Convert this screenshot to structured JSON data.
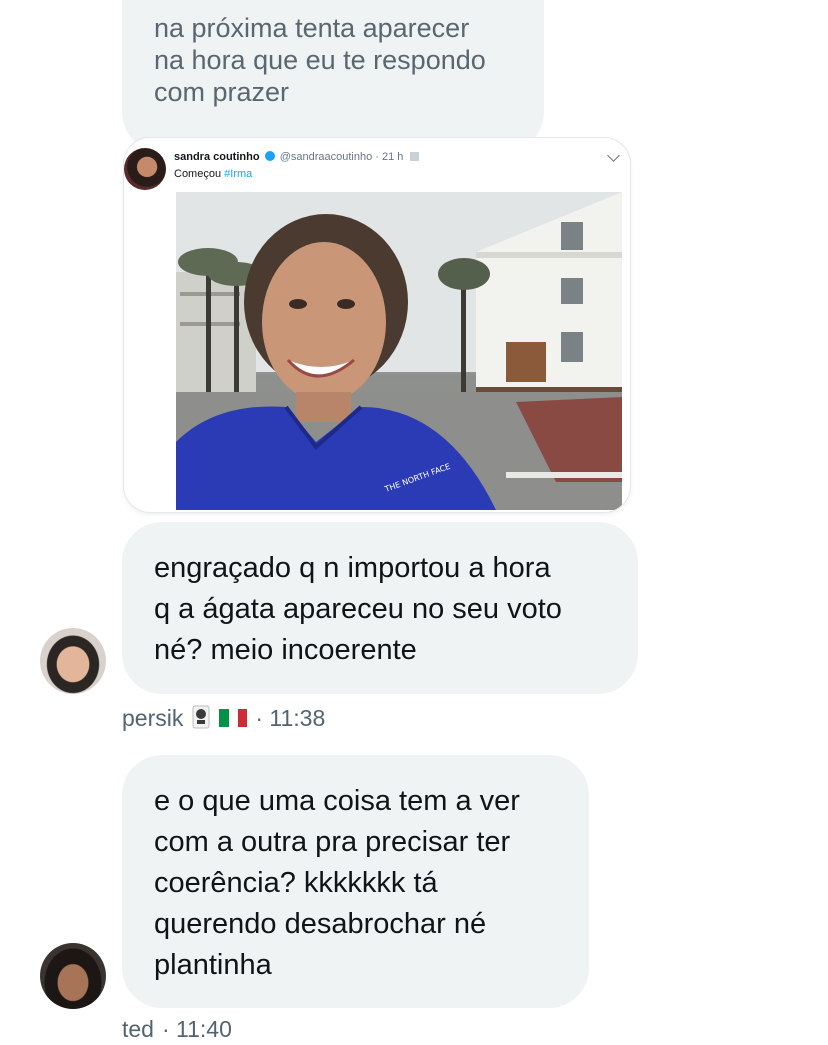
{
  "messages": [
    {
      "lines": [
        "na próxima tenta aparecer",
        "na hora que eu te respondo",
        "com prazer"
      ]
    },
    {
      "lines": [
        "engraçado q n importou a hora",
        "q a ágata apareceu no seu voto",
        "né? meio incoerente"
      ],
      "author": "persik",
      "time": "· 11:38",
      "author_icons": [
        "pin-icon",
        "italy-flag-icon"
      ]
    },
    {
      "lines": [
        "e o que uma coisa tem a ver",
        "com a outra pra precisar ter",
        "coerência? kkkkkkk tá",
        "querendo desabrochar né",
        "plantinha"
      ],
      "author": "ted",
      "time": "· 11:40"
    }
  ],
  "embedded_tweet": {
    "name": "sandra coutinho",
    "handle": "@sandraacoutinho · 21 h",
    "text": "Começou ",
    "hashtag": "#Irma",
    "photo_text": "THE NORTH FACE"
  },
  "colors": {
    "bubble_bg": "#eff3f4",
    "meta_text": "#536471",
    "link_blue": "#1da1f2",
    "jacket_blue": "#2b3bb6"
  }
}
